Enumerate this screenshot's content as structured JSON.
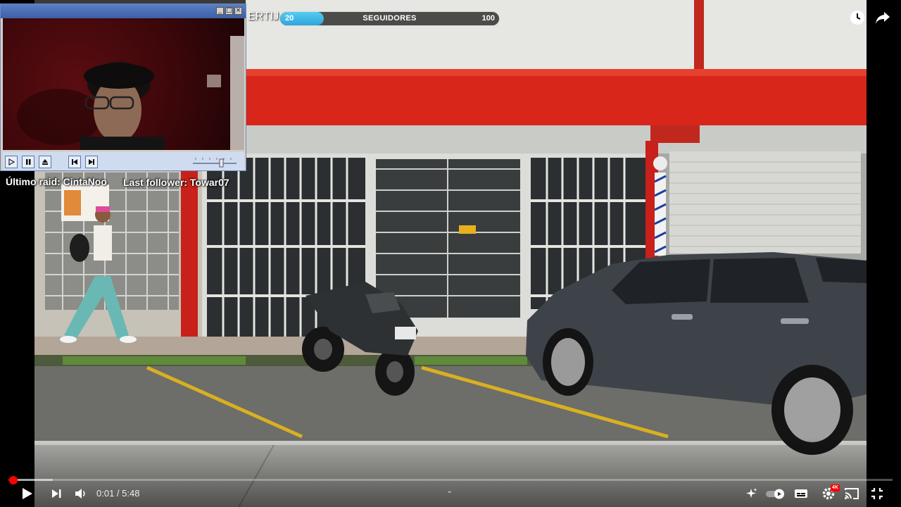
{
  "overlay": {
    "title_fragment": "ERTIJ",
    "goal": {
      "current": "20",
      "label": "SEGUIDORES",
      "target": "100",
      "progress_percent": 20
    },
    "last_raid": "Último raid: CintaNoo",
    "last_follower": "Last follower: Towar07"
  },
  "webcam_window": {
    "title_buttons": [
      "minimize-icon",
      "maximize-icon",
      "close-icon"
    ],
    "controls": [
      "play-icon",
      "pause-icon",
      "eject-icon",
      "previous-icon",
      "next-icon",
      "volume-slider"
    ]
  },
  "player": {
    "time_current": "0:01",
    "time_separator": " / ",
    "time_total": "5:48",
    "played_fraction": 0.006,
    "loaded_fraction": 0.05,
    "quality_badge": "4K",
    "chevron": "⌄",
    "accent_color": "#ff0000"
  },
  "scene": {
    "description_colors": {
      "sky_wall": "#e4e4df",
      "red_band": "#d8261a",
      "asphalt": "#6f706b",
      "sidewalk": "#b7a89a"
    }
  }
}
